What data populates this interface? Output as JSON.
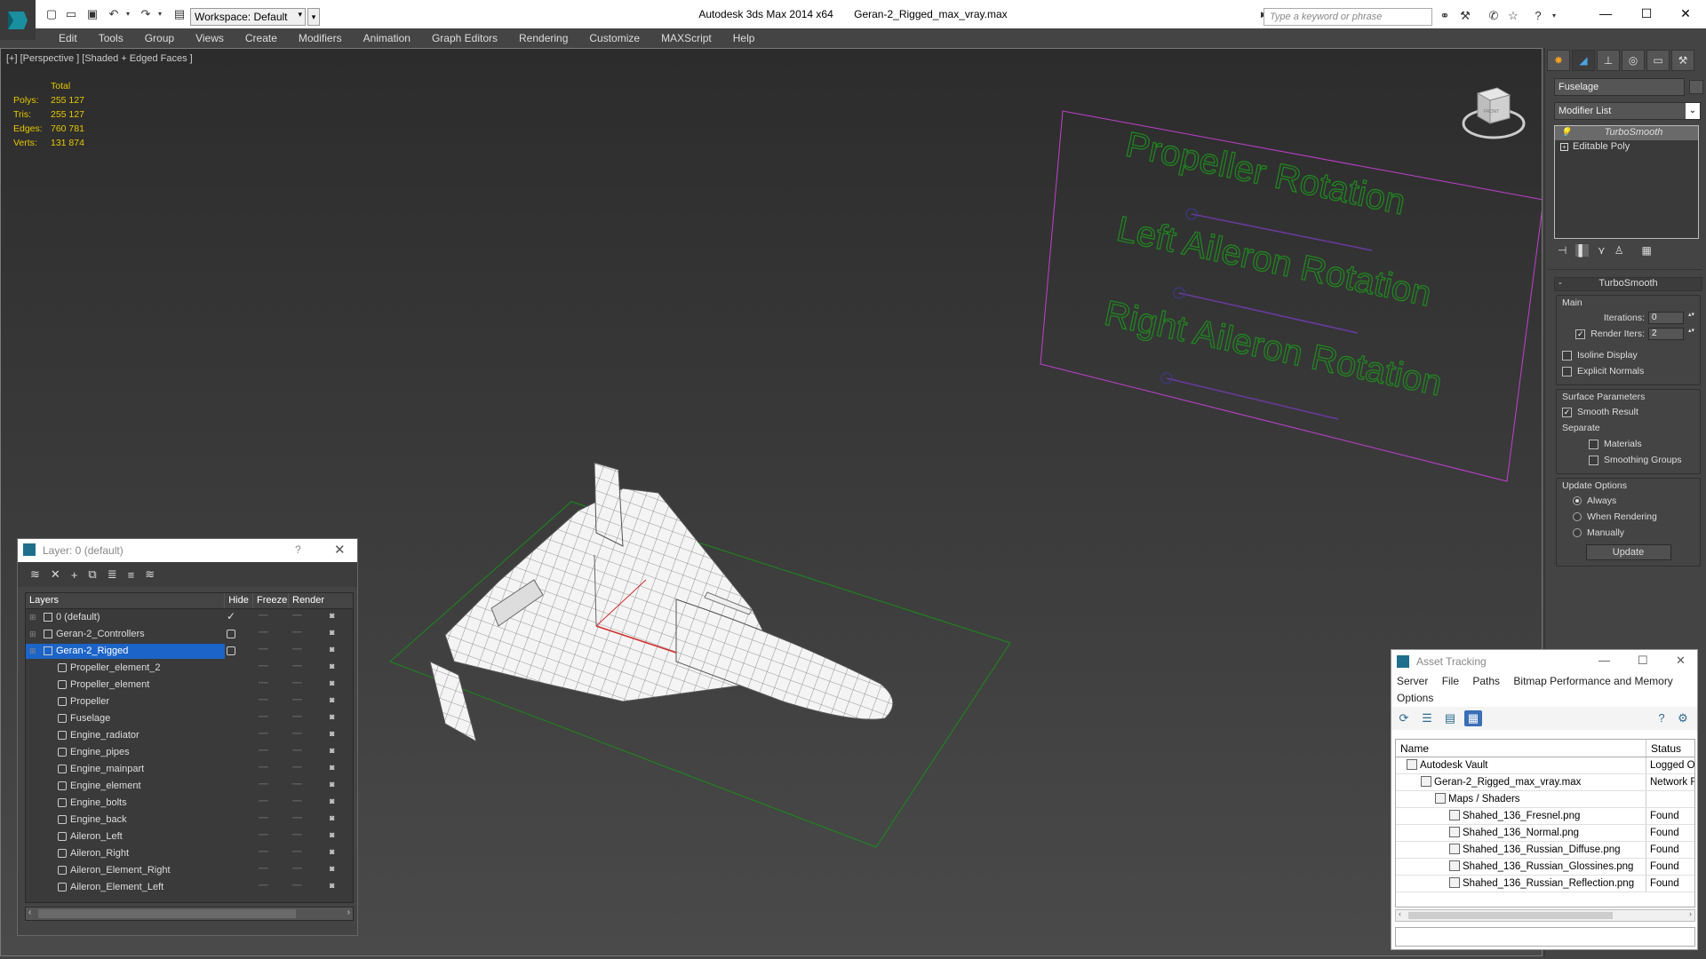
{
  "window": {
    "app_title": "Autodesk 3ds Max  2014 x64",
    "file_title": "Geran-2_Rigged_max_vray.max",
    "workspace_label": "Workspace: Default",
    "search_placeholder": "Type a keyword or phrase",
    "minimize": "—",
    "maximize": "☐",
    "close": "✕"
  },
  "menu": [
    "Edit",
    "Tools",
    "Group",
    "Views",
    "Create",
    "Modifiers",
    "Animation",
    "Graph Editors",
    "Rendering",
    "Customize",
    "MAXScript",
    "Help"
  ],
  "viewport": {
    "label": "[+] [Perspective ] [Shaded + Edged Faces ]",
    "stats": {
      "header": "Total",
      "rows": [
        {
          "k": "Polys:",
          "v": "255 127"
        },
        {
          "k": "Tris:",
          "v": "255 127"
        },
        {
          "k": "Edges:",
          "v": "760 781"
        },
        {
          "k": "Verts:",
          "v": "131 874"
        }
      ]
    },
    "rig_labels": [
      "Propeller Rotation",
      "Left Aileron Rotation",
      "Right Aileron Rotation"
    ],
    "viewcube_label": "FRONT",
    "colors": {
      "rig_text": "#1f8a1f",
      "rig_frame": "#c040d0",
      "grid": "#1a8a1a"
    }
  },
  "command_panel": {
    "object_name": "Fuselage",
    "modifier_list": "Modifier List",
    "stack": [
      "TurboSmooth",
      "Editable Poly"
    ],
    "rollout_title": "TurboSmooth",
    "main_group": "Main",
    "iterations_label": "Iterations:",
    "iterations_value": "0",
    "render_iters_label": "Render Iters:",
    "render_iters_value": "2",
    "isoline_label": "Isoline Display",
    "explicit_normals_label": "Explicit Normals",
    "surface_group": "Surface Parameters",
    "smooth_result_label": "Smooth Result",
    "separate_label": "Separate",
    "materials_label": "Materials",
    "smoothing_groups_label": "Smoothing Groups",
    "update_group": "Update Options",
    "always_label": "Always",
    "when_rendering_label": "When Rendering",
    "manually_label": "Manually",
    "update_button": "Update"
  },
  "layer_explorer": {
    "title": "Layer: 0 (default)",
    "help": "?",
    "close": "✕",
    "columns": {
      "layers": "Layers",
      "hide": "Hide",
      "freeze": "Freeze",
      "render": "Render"
    },
    "layers": [
      {
        "name": "0 (default)",
        "level": 0,
        "active": true
      },
      {
        "name": "Geran-2_Controllers",
        "level": 0
      },
      {
        "name": "Geran-2_Rigged",
        "level": 0,
        "selected": true
      },
      {
        "name": "Propeller_element_2",
        "level": 1
      },
      {
        "name": "Propeller_element",
        "level": 1
      },
      {
        "name": "Propeller",
        "level": 1
      },
      {
        "name": "Fuselage",
        "level": 1
      },
      {
        "name": "Engine_radiator",
        "level": 1
      },
      {
        "name": "Engine_pipes",
        "level": 1
      },
      {
        "name": "Engine_mainpart",
        "level": 1
      },
      {
        "name": "Engine_element",
        "level": 1
      },
      {
        "name": "Engine_bolts",
        "level": 1
      },
      {
        "name": "Engine_back",
        "level": 1
      },
      {
        "name": "Aileron_Left",
        "level": 1
      },
      {
        "name": "Aileron_Right",
        "level": 1
      },
      {
        "name": "Aileron_Element_Right",
        "level": 1
      },
      {
        "name": "Aileron_Element_Left",
        "level": 1
      }
    ]
  },
  "asset_tracking": {
    "title": "Asset Tracking",
    "menu": [
      "Server",
      "File",
      "Paths",
      "Bitmap Performance and Memory"
    ],
    "menu2": "Options",
    "columns": {
      "name": "Name",
      "status": "Status"
    },
    "rows": [
      {
        "name": "Autodesk Vault",
        "status": "Logged O",
        "indent": 1
      },
      {
        "name": "Geran-2_Rigged_max_vray.max",
        "status": "Network F",
        "indent": 2
      },
      {
        "name": "Maps / Shaders",
        "status": "",
        "indent": 3
      },
      {
        "name": "Shahed_136_Fresnel.png",
        "status": "Found",
        "indent": 4
      },
      {
        "name": "Shahed_136_Normal.png",
        "status": "Found",
        "indent": 4
      },
      {
        "name": "Shahed_136_Russian_Diffuse.png",
        "status": "Found",
        "indent": 4
      },
      {
        "name": "Shahed_136_Russian_Glossines.png",
        "status": "Found",
        "indent": 4
      },
      {
        "name": "Shahed_136_Russian_Reflection.png",
        "status": "Found",
        "indent": 4
      }
    ]
  }
}
